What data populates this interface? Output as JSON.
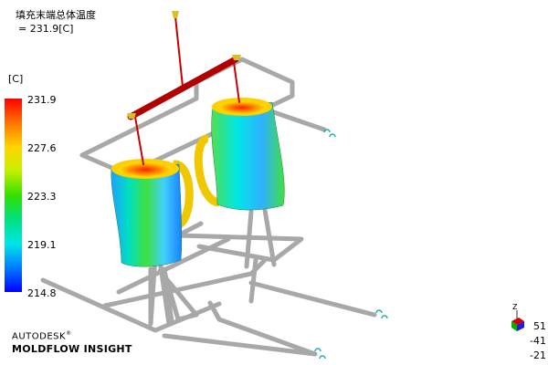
{
  "result": {
    "title": "填充末端总体温度",
    "value": "= 231.9[C]"
  },
  "scale": {
    "unit": "[C]",
    "ticks": [
      "231.9",
      "227.6",
      "223.3",
      "219.1",
      "214.8"
    ],
    "max": 231.9,
    "min": 214.8,
    "colors": [
      "#ff0000",
      "#ffd400",
      "#33e000",
      "#00e6e6",
      "#0000ff"
    ]
  },
  "brand": {
    "company": "AUTODESK",
    "product": "MOLDFLOW INSIGHT",
    "trademark": "®"
  },
  "triad": {
    "axis_label": "Z",
    "readouts": [
      "51",
      "-41",
      "-21"
    ]
  },
  "model": {
    "parts": [
      "mug-left",
      "mug-right"
    ],
    "runner_color": "#c80000",
    "cooling_line_color": "#a8a8a8",
    "handle_color": "#f0c800"
  }
}
